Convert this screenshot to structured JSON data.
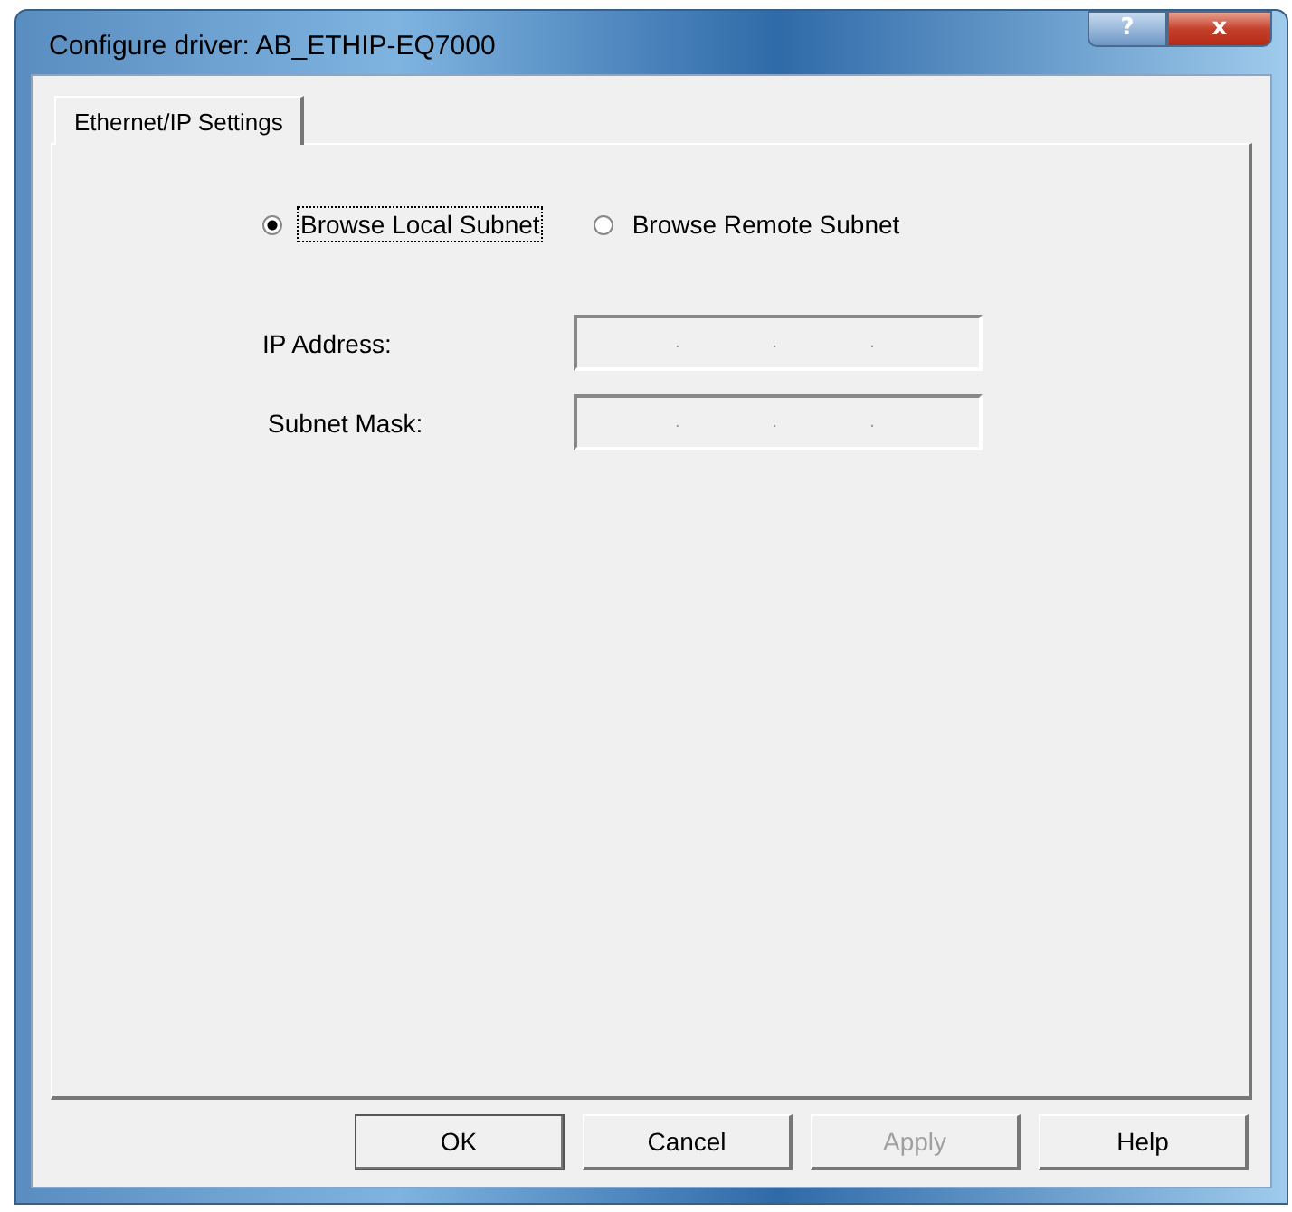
{
  "window": {
    "title": "Configure driver: AB_ETHIP-EQ7000",
    "controls": [
      {
        "kind": "help",
        "label": "?"
      },
      {
        "kind": "close",
        "label": "x"
      }
    ]
  },
  "tabs": [
    {
      "label": "Ethernet/IP Settings",
      "selected": true
    }
  ],
  "browse_mode": [
    {
      "label": "Browse Local Subnet",
      "selected": true,
      "focused": true
    },
    {
      "label": "Browse Remote Subnet",
      "selected": false,
      "focused": false
    }
  ],
  "fields": [
    {
      "label": "IP Address:",
      "disabled": true,
      "separators": [
        ".",
        ".",
        "."
      ]
    },
    {
      "label": "Subnet Mask:",
      "disabled": true,
      "separators": [
        ".",
        ".",
        "."
      ]
    }
  ],
  "buttons": [
    {
      "label": "OK",
      "disabled": false,
      "default": true
    },
    {
      "label": "Cancel",
      "disabled": false,
      "default": false
    },
    {
      "label": "Apply",
      "disabled": true,
      "default": false
    },
    {
      "label": "Help",
      "disabled": false,
      "default": false
    }
  ]
}
